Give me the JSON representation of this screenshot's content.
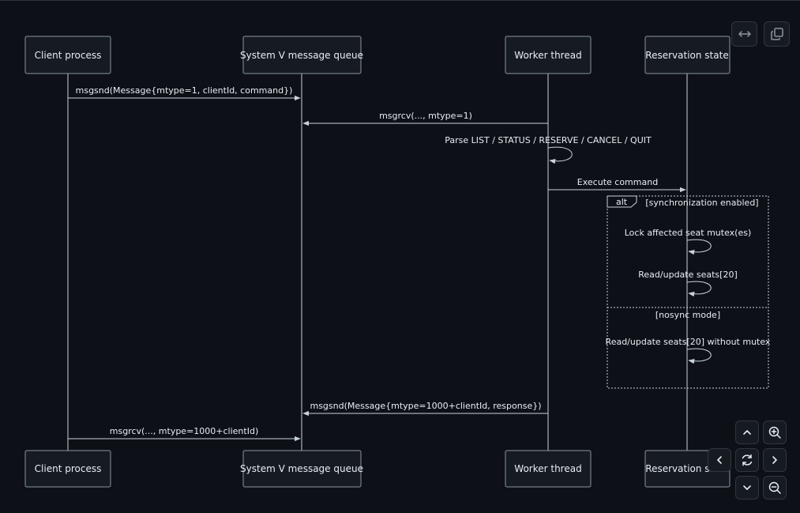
{
  "participants": [
    {
      "id": "client",
      "label": "Client process"
    },
    {
      "id": "queue",
      "label": "System V message queue"
    },
    {
      "id": "worker",
      "label": "Worker thread"
    },
    {
      "id": "state",
      "label": "Reservation state"
    }
  ],
  "messages": [
    {
      "from": "client",
      "to": "queue",
      "text": "msgsnd(Message{mtype=1, clientId, command})"
    },
    {
      "from": "worker",
      "to": "queue",
      "text": "msgrcv(..., mtype=1)"
    },
    {
      "from": "worker",
      "to": "worker",
      "text": "Parse LIST / STATUS / RESERVE / CANCEL / QUIT"
    },
    {
      "from": "worker",
      "to": "state",
      "text": "Execute command"
    },
    {
      "from": "state",
      "to": "state",
      "text": "Lock affected seat mutex(es)"
    },
    {
      "from": "state",
      "to": "state",
      "text": "Read/update seats[20]"
    },
    {
      "from": "state",
      "to": "state",
      "text": "Read/update seats[20] without mutex"
    },
    {
      "from": "worker",
      "to": "queue",
      "text": "msgsnd(Message{mtype=1000+clientId, response})"
    },
    {
      "from": "queue",
      "to": "client",
      "text": "msgrcv(..., mtype=1000+clientId)"
    }
  ],
  "fragment": {
    "kind": "alt",
    "conditions": [
      "[synchronization enabled]",
      "[nosync mode]"
    ]
  },
  "controls": [
    {
      "name": "fit-width-button",
      "icon": "horizontal-arrows-icon"
    },
    {
      "name": "copy-button",
      "icon": "copy-icon"
    },
    {
      "name": "pan-up-button",
      "icon": "chevron-up-icon"
    },
    {
      "name": "zoom-in-button",
      "icon": "zoom-in-icon"
    },
    {
      "name": "pan-left-button",
      "icon": "chevron-left-icon"
    },
    {
      "name": "reset-view-button",
      "icon": "refresh-icon"
    },
    {
      "name": "pan-right-button",
      "icon": "chevron-right-icon"
    },
    {
      "name": "pan-down-button",
      "icon": "chevron-down-icon"
    },
    {
      "name": "zoom-out-button",
      "icon": "zoom-out-icon"
    }
  ],
  "colors": {
    "background": "#0d1117",
    "line": "#c9d1d9",
    "box_fill": "#161b22",
    "box_stroke": "#8b949e",
    "text": "#e6edf3"
  }
}
